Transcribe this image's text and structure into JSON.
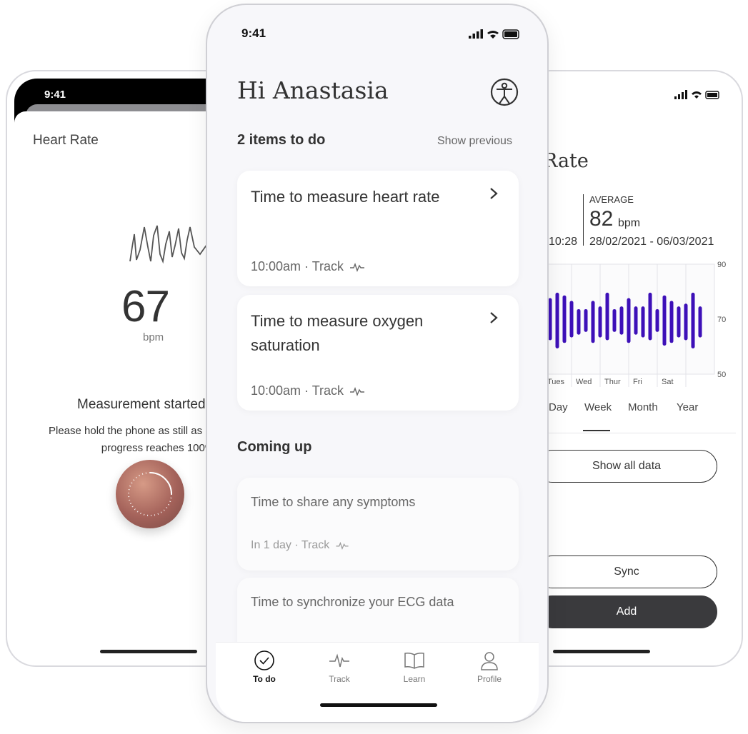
{
  "left_screen": {
    "status_time": "9:41",
    "title": "Heart Rate",
    "bpm_value": "67",
    "bpm_unit": "bpm",
    "message_title": "Measurement started",
    "message_body": "Please hold the phone as still as possible until progress reaches 100%"
  },
  "center_screen": {
    "status_time": "9:41",
    "greeting": "Hi Anastasia",
    "todo_title": "2 items to do",
    "show_previous": "Show previous",
    "todo_items": [
      {
        "title": "Time to measure heart rate",
        "meta": "10:00am · Track"
      },
      {
        "title": "Time to measure oxygen saturation",
        "meta": "10:00am · Track"
      }
    ],
    "coming_up_title": "Coming up",
    "coming_items": [
      {
        "title": "Time to share any symptoms",
        "meta": "In 1 day · Track"
      },
      {
        "title": "Time to synchronize your ECG data"
      }
    ],
    "tabs": [
      {
        "label": "To do",
        "icon": "check-circle-icon",
        "active": true
      },
      {
        "label": "Track",
        "icon": "pulse-icon"
      },
      {
        "label": "Learn",
        "icon": "book-icon"
      },
      {
        "label": "Profile",
        "icon": "person-icon"
      }
    ]
  },
  "right_screen": {
    "title_fragment": "Rate",
    "average_label": "AVERAGE",
    "average_value": "82",
    "average_unit": "bpm",
    "left_time": "10:28",
    "date_range": "28/02/2021 - 06/03/2021",
    "tabs": [
      "Day",
      "Week",
      "Month",
      "Year"
    ],
    "active_tab": "Week",
    "show_all_button": "Show all data",
    "sync_button": "Sync",
    "add_button": "Add",
    "accent_color": "#3d10b8"
  },
  "chart_data": {
    "type": "bar",
    "y_ticks": [
      90,
      70,
      50
    ],
    "ylim": [
      50,
      90
    ],
    "x_labels": [
      "Tues",
      "Wed",
      "Thur",
      "Fri",
      "Sat"
    ],
    "bars": [
      {
        "low": 63,
        "high": 77
      },
      {
        "low": 60,
        "high": 79
      },
      {
        "low": 62,
        "high": 78
      },
      {
        "low": 64,
        "high": 76
      },
      {
        "low": 65,
        "high": 73
      },
      {
        "low": 66,
        "high": 73
      },
      {
        "low": 62,
        "high": 76
      },
      {
        "low": 64,
        "high": 74
      },
      {
        "low": 63,
        "high": 79
      },
      {
        "low": 66,
        "high": 73
      },
      {
        "low": 65,
        "high": 74
      },
      {
        "low": 62,
        "high": 77
      },
      {
        "low": 65,
        "high": 74
      },
      {
        "low": 64,
        "high": 74
      },
      {
        "low": 63,
        "high": 79
      },
      {
        "low": 66,
        "high": 73
      },
      {
        "low": 61,
        "high": 78
      },
      {
        "low": 62,
        "high": 76
      },
      {
        "low": 64,
        "high": 74
      },
      {
        "low": 63,
        "high": 75
      },
      {
        "low": 60,
        "high": 79
      },
      {
        "low": 64,
        "high": 74
      }
    ]
  }
}
